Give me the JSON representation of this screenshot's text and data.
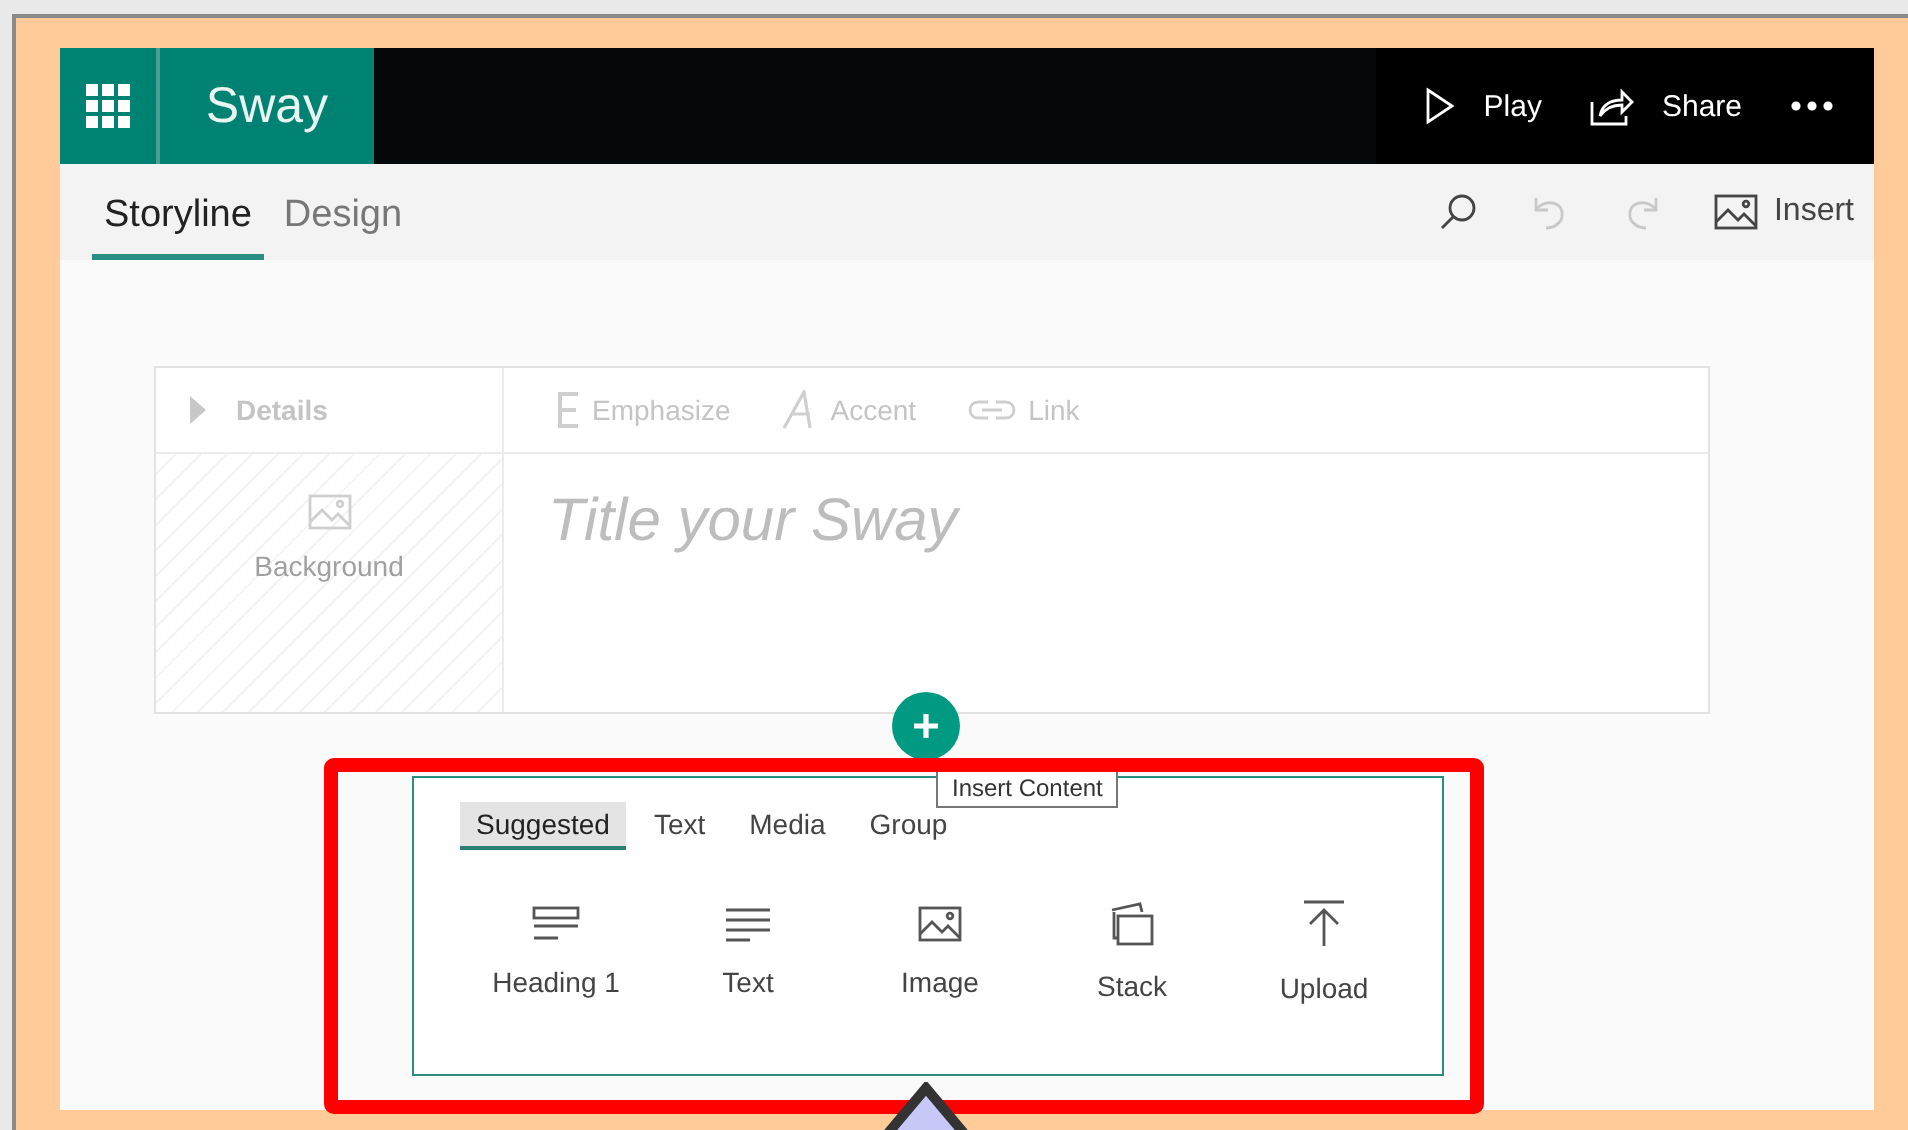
{
  "app": {
    "name": "Sway"
  },
  "header_actions": [
    {
      "kind": "play",
      "label": "Play"
    },
    {
      "kind": "share",
      "label": "Share"
    },
    {
      "kind": "more"
    }
  ],
  "tabs": [
    {
      "label": "Storyline",
      "selected": true
    },
    {
      "label": "Design",
      "selected": false
    }
  ],
  "toolbar": [
    {
      "kind": "search",
      "disabled": false
    },
    {
      "kind": "undo",
      "disabled": true
    },
    {
      "kind": "redo",
      "disabled": true
    },
    {
      "kind": "insert",
      "label": "Insert",
      "disabled": false
    }
  ],
  "title_card": {
    "details_label": "Details",
    "background_label": "Background",
    "title_placeholder": "Title your Sway",
    "formatting": [
      {
        "kind": "emphasize",
        "label": "Emphasize"
      },
      {
        "kind": "accent",
        "label": "Accent"
      },
      {
        "kind": "link",
        "label": "Link"
      }
    ]
  },
  "tooltip": "Insert Content",
  "insert_panel": {
    "tabs": [
      {
        "label": "Suggested",
        "selected": true
      },
      {
        "label": "Text",
        "selected": false
      },
      {
        "label": "Media",
        "selected": false
      },
      {
        "label": "Group",
        "selected": false
      }
    ],
    "items": [
      {
        "kind": "heading",
        "label": "Heading 1"
      },
      {
        "kind": "text",
        "label": "Text"
      },
      {
        "kind": "image",
        "label": "Image"
      },
      {
        "kind": "stack",
        "label": "Stack"
      },
      {
        "kind": "upload",
        "label": "Upload"
      }
    ]
  }
}
